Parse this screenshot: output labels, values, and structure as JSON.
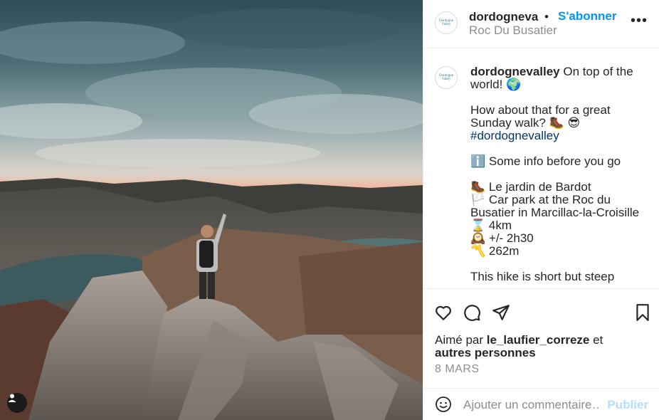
{
  "post": {
    "username": "dordognevalley",
    "username_truncated": "dordogneva",
    "dot": "•",
    "follow_label": "S'abonner",
    "location": "Roc Du Busatier",
    "more_label": "•••",
    "avatar_text": "Dordogne Valley"
  },
  "caption": {
    "username": "dordognevalley",
    "line1": "On top of the world! 🌍",
    "line2": "How about that for a great Sunday walk? 🥾 😎",
    "hashtag": "#dordognevalley",
    "info": "ℹ️ Some info before you go",
    "item1": "🥾 Le jardin de Bardot",
    "item2": "🏳️ Car park at the Roc du Busatier in Marcillac-la-Croisille",
    "item3": "⌛ 4km",
    "item4": "🕰️ +/- 2h30",
    "item5": "〽️ 262m",
    "item6": "This hike is short but steep"
  },
  "engagement": {
    "liked_by_prefix": "Aimé par",
    "liked_by_user": "le_laufier_correze",
    "liked_by_suffix": "et",
    "others": "autres personnes",
    "date": "8 MARS"
  },
  "comment_box": {
    "placeholder": "Ajouter un commentaire…",
    "publish_label": "Publier"
  },
  "icons": {
    "like": "heart-icon",
    "comment": "comment-icon",
    "share": "share-icon",
    "save": "bookmark-icon",
    "emoji": "emoji-icon",
    "tag": "user-tag-icon"
  },
  "colors": {
    "accent": "#0095f6",
    "publish_disabled": "#b2dffc",
    "muted": "#8e8e8e",
    "hashtag": "#00376b"
  }
}
